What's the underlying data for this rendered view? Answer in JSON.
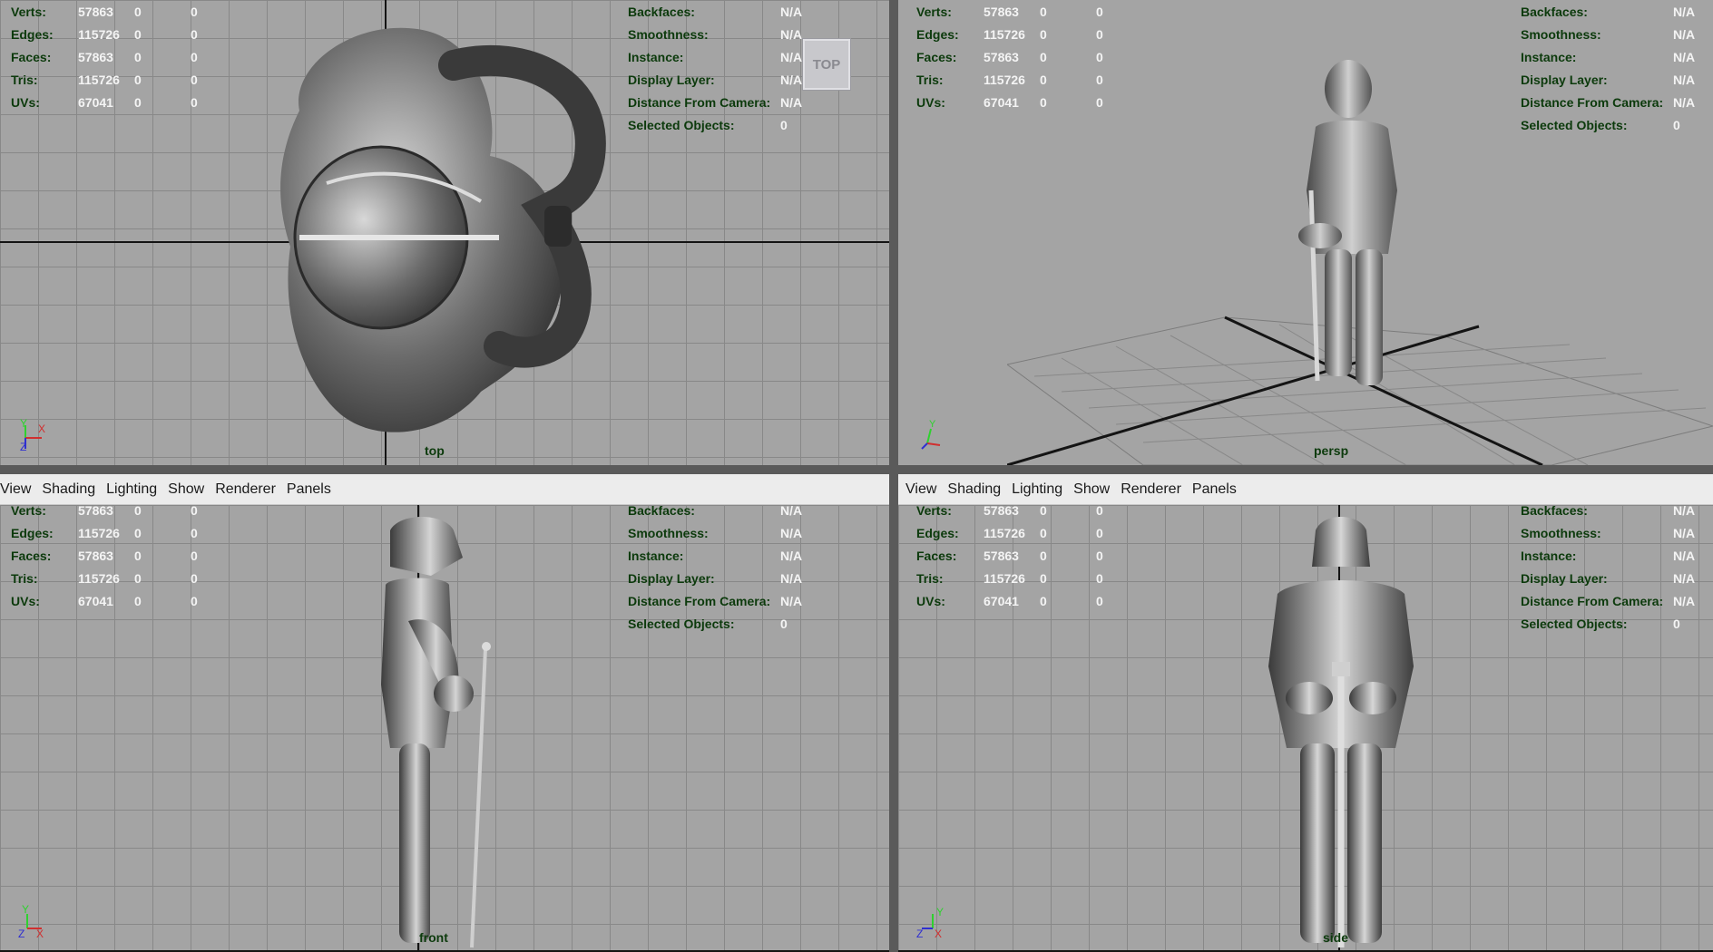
{
  "menu": [
    "View",
    "Shading",
    "Lighting",
    "Show",
    "Renderer",
    "Panels"
  ],
  "hud_left": [
    {
      "label": "Verts:",
      "v1": "57863",
      "v2": "0",
      "v3": "0"
    },
    {
      "label": "Edges:",
      "v1": "115726",
      "v2": "0",
      "v3": "0"
    },
    {
      "label": "Faces:",
      "v1": "57863",
      "v2": "0",
      "v3": "0"
    },
    {
      "label": "Tris:",
      "v1": "115726",
      "v2": "0",
      "v3": "0"
    },
    {
      "label": "UVs:",
      "v1": "67041",
      "v2": "0",
      "v3": "0"
    }
  ],
  "hud_right": [
    {
      "label": "Backfaces:",
      "value": "N/A"
    },
    {
      "label": "Smoothness:",
      "value": "N/A"
    },
    {
      "label": "Instance:",
      "value": "N/A"
    },
    {
      "label": "Display Layer:",
      "value": "N/A"
    },
    {
      "label": "Distance From Camera:",
      "value": "N/A"
    },
    {
      "label": "Selected Objects:",
      "value": "0"
    }
  ],
  "viewports": {
    "top": {
      "camera": "top",
      "viewcube": "TOP",
      "axes": [
        "Y",
        "X",
        "Z"
      ]
    },
    "persp": {
      "camera": "persp",
      "axes": [
        "Y",
        "X",
        "Z"
      ]
    },
    "front": {
      "camera": "front",
      "axes": [
        "Y",
        "Z",
        "X"
      ]
    },
    "side": {
      "camera": "side",
      "axes": [
        "Y",
        "Z",
        "X"
      ]
    }
  },
  "colors": {
    "hud_label": "#0c3a0c",
    "hud_value": "#f4f4f4",
    "viewport_bg": "#a4a4a4",
    "grid": "#888888"
  }
}
